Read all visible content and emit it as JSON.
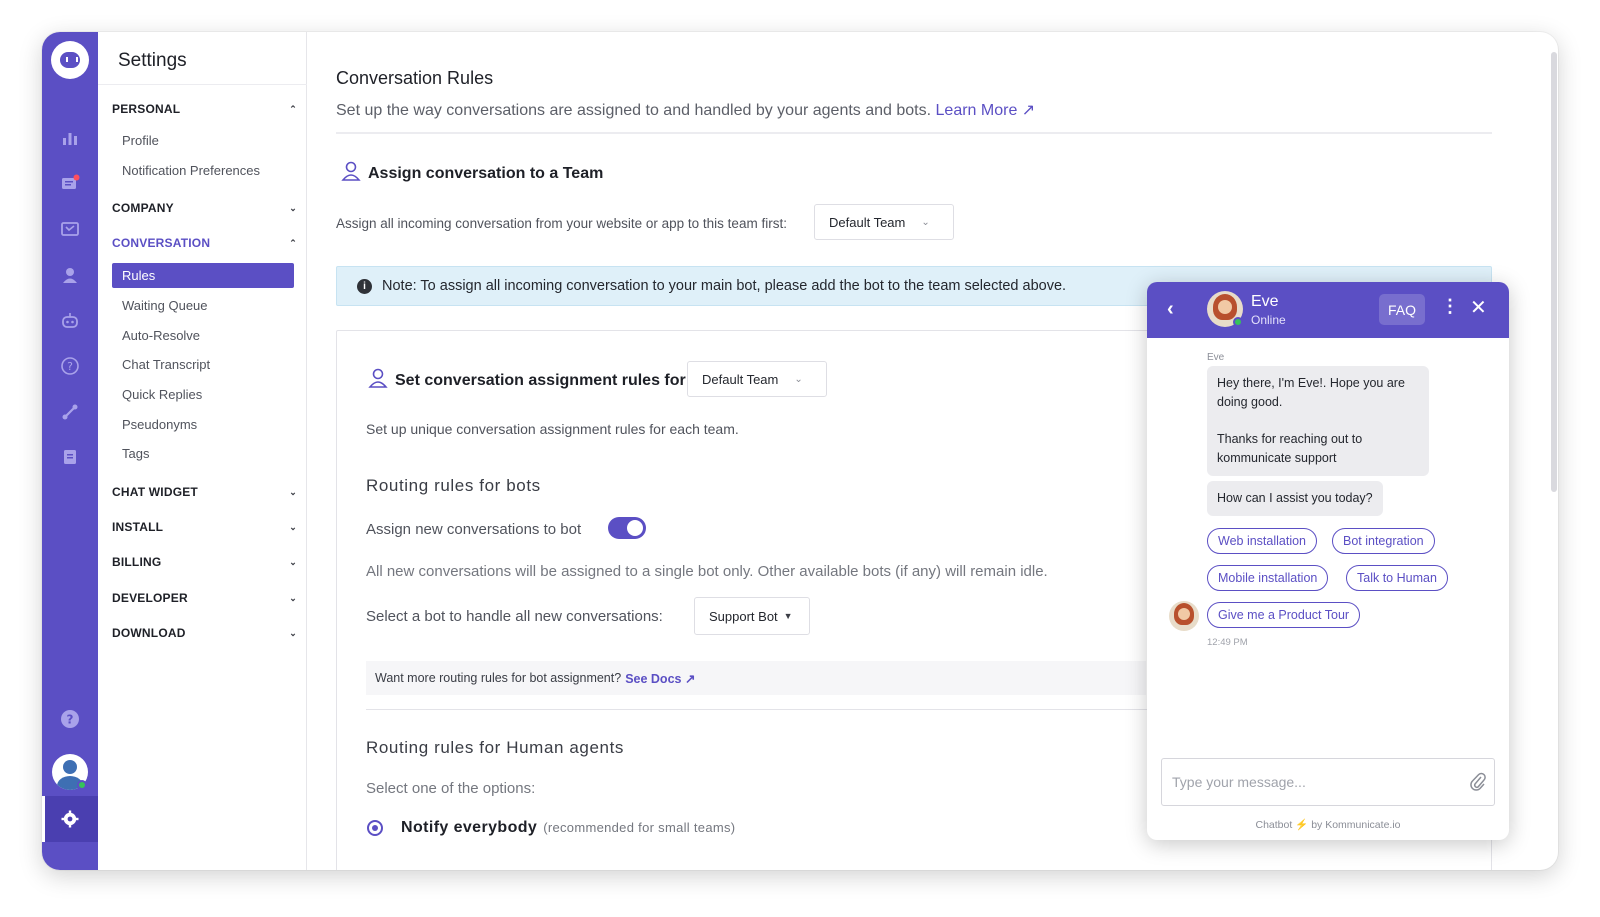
{
  "nav": {
    "title": "Settings",
    "sections": [
      {
        "label": "PERSONAL",
        "expanded": true,
        "items": [
          "Profile",
          "Notification Preferences"
        ]
      },
      {
        "label": "COMPANY",
        "expanded": false
      },
      {
        "label": "CONVERSATION",
        "expanded": true,
        "active": true,
        "items": [
          "Rules",
          "Waiting Queue",
          "Auto-Resolve",
          "Chat Transcript",
          "Quick Replies",
          "Pseudonyms",
          "Tags"
        ],
        "selected": "Rules"
      },
      {
        "label": "CHAT WIDGET",
        "expanded": false
      },
      {
        "label": "INSTALL",
        "expanded": false
      },
      {
        "label": "BILLING",
        "expanded": false
      },
      {
        "label": "DEVELOPER",
        "expanded": false
      },
      {
        "label": "DOWNLOAD",
        "expanded": false
      }
    ]
  },
  "main": {
    "title": "Conversation Rules",
    "subtitle": "Set up the way conversations are assigned to and handled by your agents and bots.",
    "learn_more": "Learn More",
    "assign_team_heading": "Assign conversation to a Team",
    "assign_team_label": "Assign all incoming conversation from your website or app to this team first:",
    "assign_team_value": "Default Team",
    "note": "Note: To assign all incoming conversation to your main bot, please add the bot to the team selected above.",
    "rules_heading": "Set conversation assignment rules for",
    "rules_team_value": "Default Team",
    "rules_desc": "Set up unique conversation assignment rules for each team.",
    "bots_title": "Routing rules for bots",
    "assign_bot_label": "Assign new conversations to bot",
    "assign_bot_enabled": true,
    "bot_desc": "All new conversations will be assigned to a single bot only. Other available bots (if any) will remain idle.",
    "select_bot_label": "Select a bot to handle all new conversations:",
    "select_bot_value": "Support Bot",
    "docs_text": "Want more routing rules for bot assignment?",
    "docs_link": "See Docs",
    "human_title": "Routing rules for Human agents",
    "human_desc": "Select one of the options:",
    "option_label": "Notify everybody",
    "option_hint": "(recommended for small teams)"
  },
  "widget": {
    "agent_name": "Eve",
    "agent_status": "Online",
    "faq_label": "FAQ",
    "sender": "Eve",
    "message1": "Hey there, I'm Eve!. Hope you are doing good.",
    "message2": "Thanks for reaching out to kommunicate support",
    "message3": "How can I assist you today?",
    "quick_replies": [
      "Web installation",
      "Bot integration",
      "Mobile installation",
      "Talk to Human",
      "Give me a Product Tour"
    ],
    "time": "12:49 PM",
    "input_placeholder": "Type your message...",
    "powered_prefix": "Chatbot",
    "powered_suffix": "by Kommunicate.io"
  },
  "colors": {
    "accent": "#5b4fc4",
    "note_bg": "#dff0f9",
    "online": "#35c45a"
  }
}
